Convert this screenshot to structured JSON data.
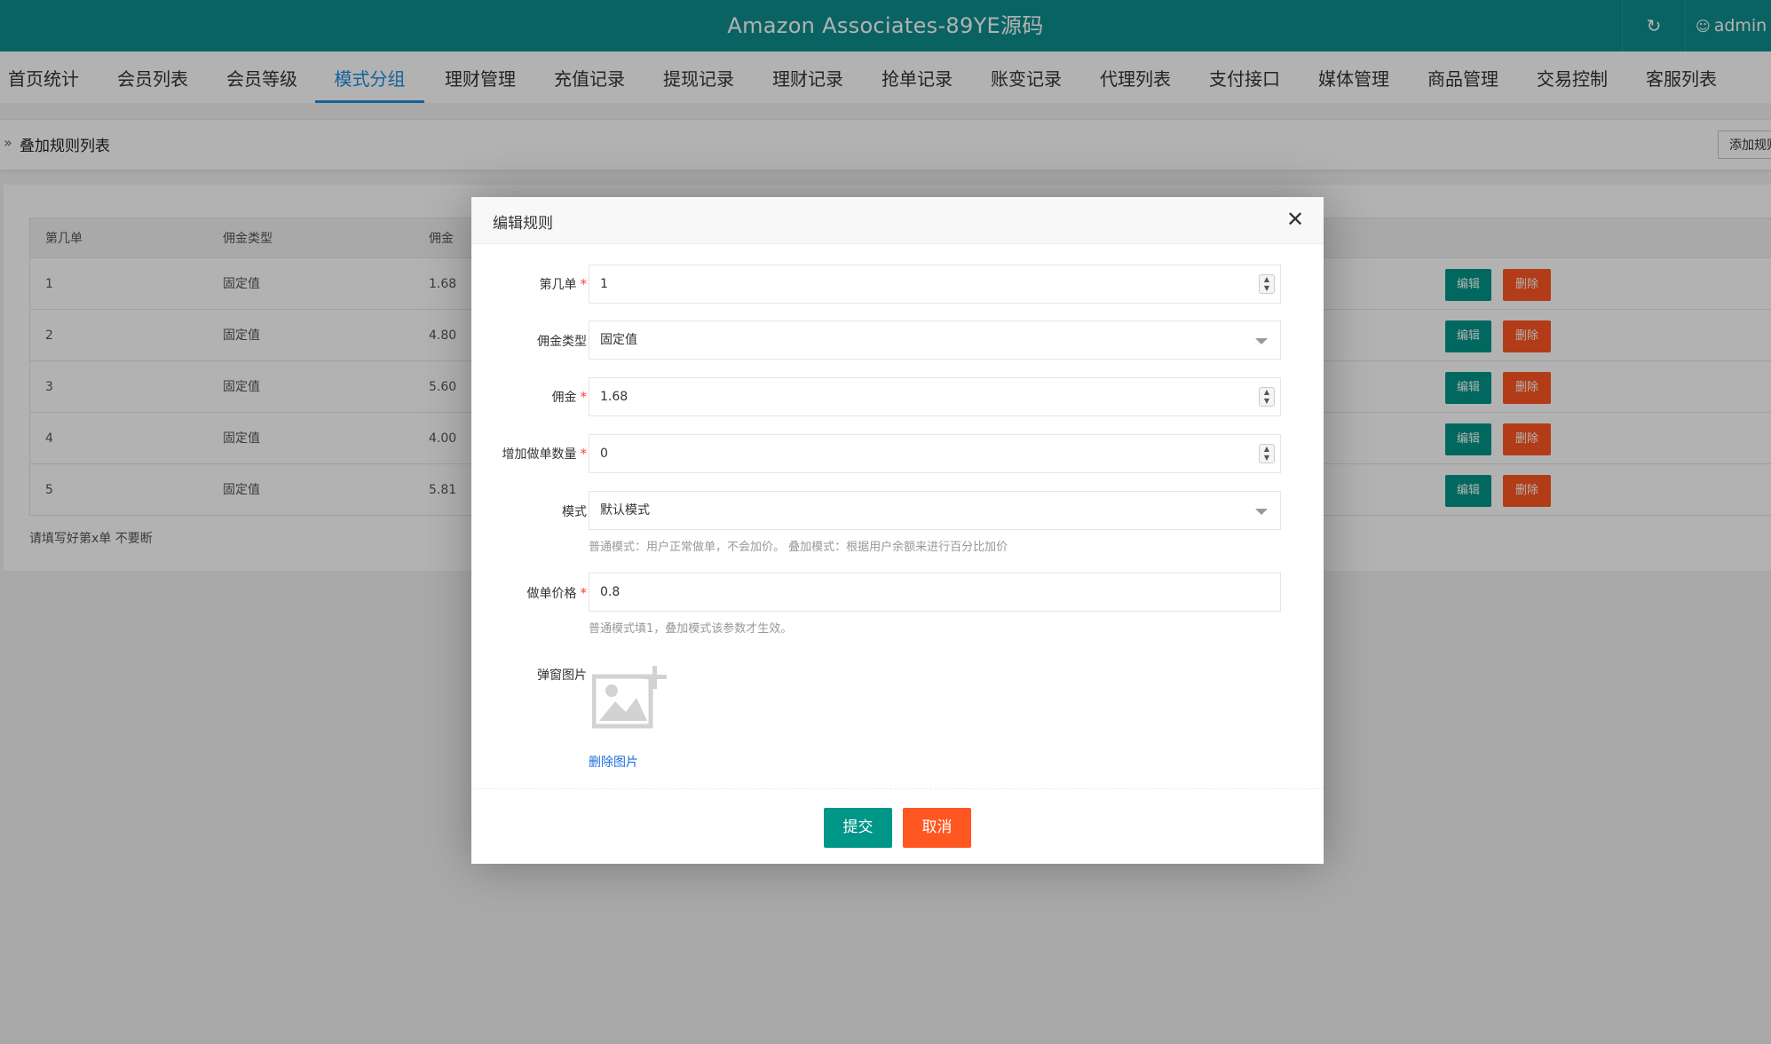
{
  "header": {
    "title": "Amazon Associates-89YE源码",
    "refresh_icon": "refresh-icon",
    "user_icon": "user-icon",
    "user_name": "admin"
  },
  "nav": {
    "items": [
      "首页统计",
      "会员列表",
      "会员等级",
      "模式分组",
      "理财管理",
      "充值记录",
      "提现记录",
      "理财记录",
      "抢单记录",
      "账变记录",
      "代理列表",
      "支付接口",
      "媒体管理",
      "商品管理",
      "交易控制",
      "客服列表"
    ],
    "active": "模式分组"
  },
  "breadcrumb": {
    "arrow": "»",
    "title": "叠加规则列表",
    "add_button": "添加规则"
  },
  "table": {
    "headers": [
      "第几单",
      "佣金类型",
      "佣金"
    ],
    "rows": [
      {
        "order": "1",
        "type": "固定值",
        "commission": "1.68"
      },
      {
        "order": "2",
        "type": "固定值",
        "commission": "4.80"
      },
      {
        "order": "3",
        "type": "固定值",
        "commission": "5.60"
      },
      {
        "order": "4",
        "type": "固定值",
        "commission": "4.00"
      },
      {
        "order": "5",
        "type": "固定值",
        "commission": "5.81"
      }
    ],
    "edit_label": "编辑",
    "delete_label": "删除",
    "note": "请填写好第x单 不要断"
  },
  "modal": {
    "title": "编辑规则",
    "fields": {
      "order": {
        "label": "第几单",
        "value": "1",
        "required": true
      },
      "commission_type": {
        "label": "佣金类型",
        "value": "固定值"
      },
      "commission": {
        "label": "佣金",
        "value": "1.68",
        "required": true
      },
      "extra_orders": {
        "label": "增加做单数量",
        "value": "0",
        "required": true
      },
      "mode": {
        "label": "模式",
        "value": "默认模式",
        "help": "普通模式：用户正常做单，不会加价。 叠加模式：根据用户余额来进行百分比加价"
      },
      "price": {
        "label": "做单价格",
        "value": "0.8",
        "required": true,
        "help": "普通模式填1，叠加模式该参数才生效。"
      },
      "popup_image": {
        "label": "弹窗图片",
        "delete_label": "删除图片"
      }
    },
    "submit_label": "提交",
    "cancel_label": "取消",
    "required_mark": "*"
  },
  "colors": {
    "topbar": "#0f8e8e",
    "nav_active": "#1e8ddb",
    "primary_button": "#009688",
    "danger_button": "#ff5722",
    "link": "#1e6fd9"
  }
}
